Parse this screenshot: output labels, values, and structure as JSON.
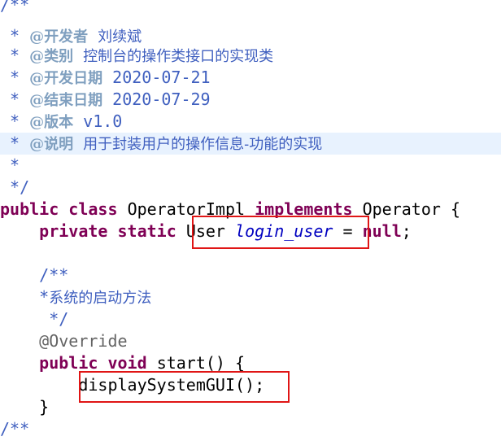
{
  "code": {
    "doc_open": "/**",
    "star": " * ",
    "tag_developer": "@开发者",
    "developer": "刘续斌",
    "tag_category": "@类别",
    "category": "控制台的操作类接口的实现类",
    "tag_start_date": "@开发日期",
    "start_date": "2020-07-21",
    "tag_end_date": "@结束日期",
    "end_date": "2020-07-29",
    "tag_version": "@版本",
    "version": "v1.0",
    "tag_description": "@说明",
    "description": "用于封装用户的操作信息-功能的实现",
    "empty_star": " *",
    "doc_close": " */",
    "kw_public": "public",
    "kw_class": "class",
    "class_name": "OperatorImpl",
    "kw_implements": "implements",
    "interface_name": "Operator {",
    "kw_private": "private",
    "kw_static": "static",
    "type_user": "User",
    "field_login_user": "login_user",
    "assign": "=",
    "kw_null": "null",
    "semicolon": ";",
    "inner_doc_open": "/**",
    "inner_star": "*",
    "inner_comment": "系统的启动方法",
    "inner_doc_close": "*/",
    "annotation": "@Override",
    "kw_void": "void",
    "method_sig": "start() {",
    "method_call": "displaySystemGUI();",
    "close_brace": "}",
    "next_doc_open": "/**"
  },
  "colors": {
    "keyword": "#7f0055",
    "comment": "#3f5fbf",
    "field": "#0000c0",
    "highlight": "#e8f2fe",
    "box": "#e01515"
  }
}
